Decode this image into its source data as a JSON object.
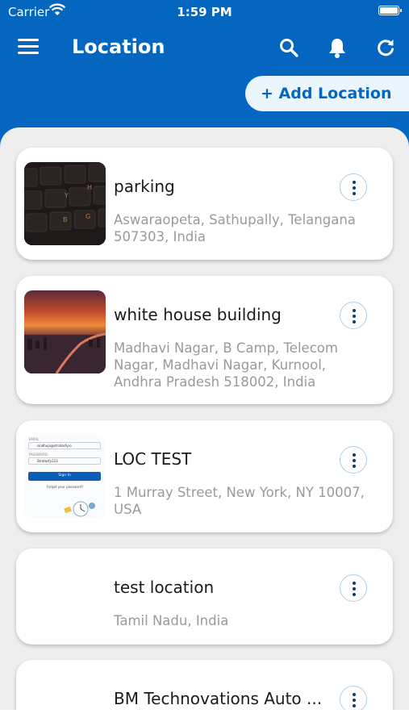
{
  "status": {
    "carrier": "Carrier",
    "time": "1:59 PM"
  },
  "header": {
    "title": "Location"
  },
  "add_button": {
    "label": "+ Add Location"
  },
  "cards": [
    {
      "title": "parking",
      "address": "Aswaraopeta, Sathupally, Telangana 507303, India"
    },
    {
      "title": "white house building",
      "address": "Madhavi Nagar, B Camp, Telecom Nagar, Madhavi Nagar, Kurnool, Andhra Pradesh 518002, India"
    },
    {
      "title": "LOC TEST",
      "address": "1 Murray Street, New York, NY 10007, USA"
    },
    {
      "title": "test location",
      "address": "Tamil Nadu, India"
    },
    {
      "title": "BM Technovations Auto ..."
    }
  ],
  "thumb_login": {
    "email_label": "EMAIL",
    "email_value": "sindhuja@stratosfy.io",
    "password_label": "PASSWORD",
    "password_value": "Stratosfy123",
    "signin_label": "Sign In",
    "forgot_label": "Forgot your password?"
  },
  "colors": {
    "primary": "#0566c0",
    "background": "#eeeeee",
    "accent_light": "#eaf6fb"
  },
  "icons": [
    "wifi-icon",
    "battery-icon",
    "menu-icon",
    "search-icon",
    "bell-icon",
    "refresh-icon",
    "more-vertical-icon"
  ]
}
